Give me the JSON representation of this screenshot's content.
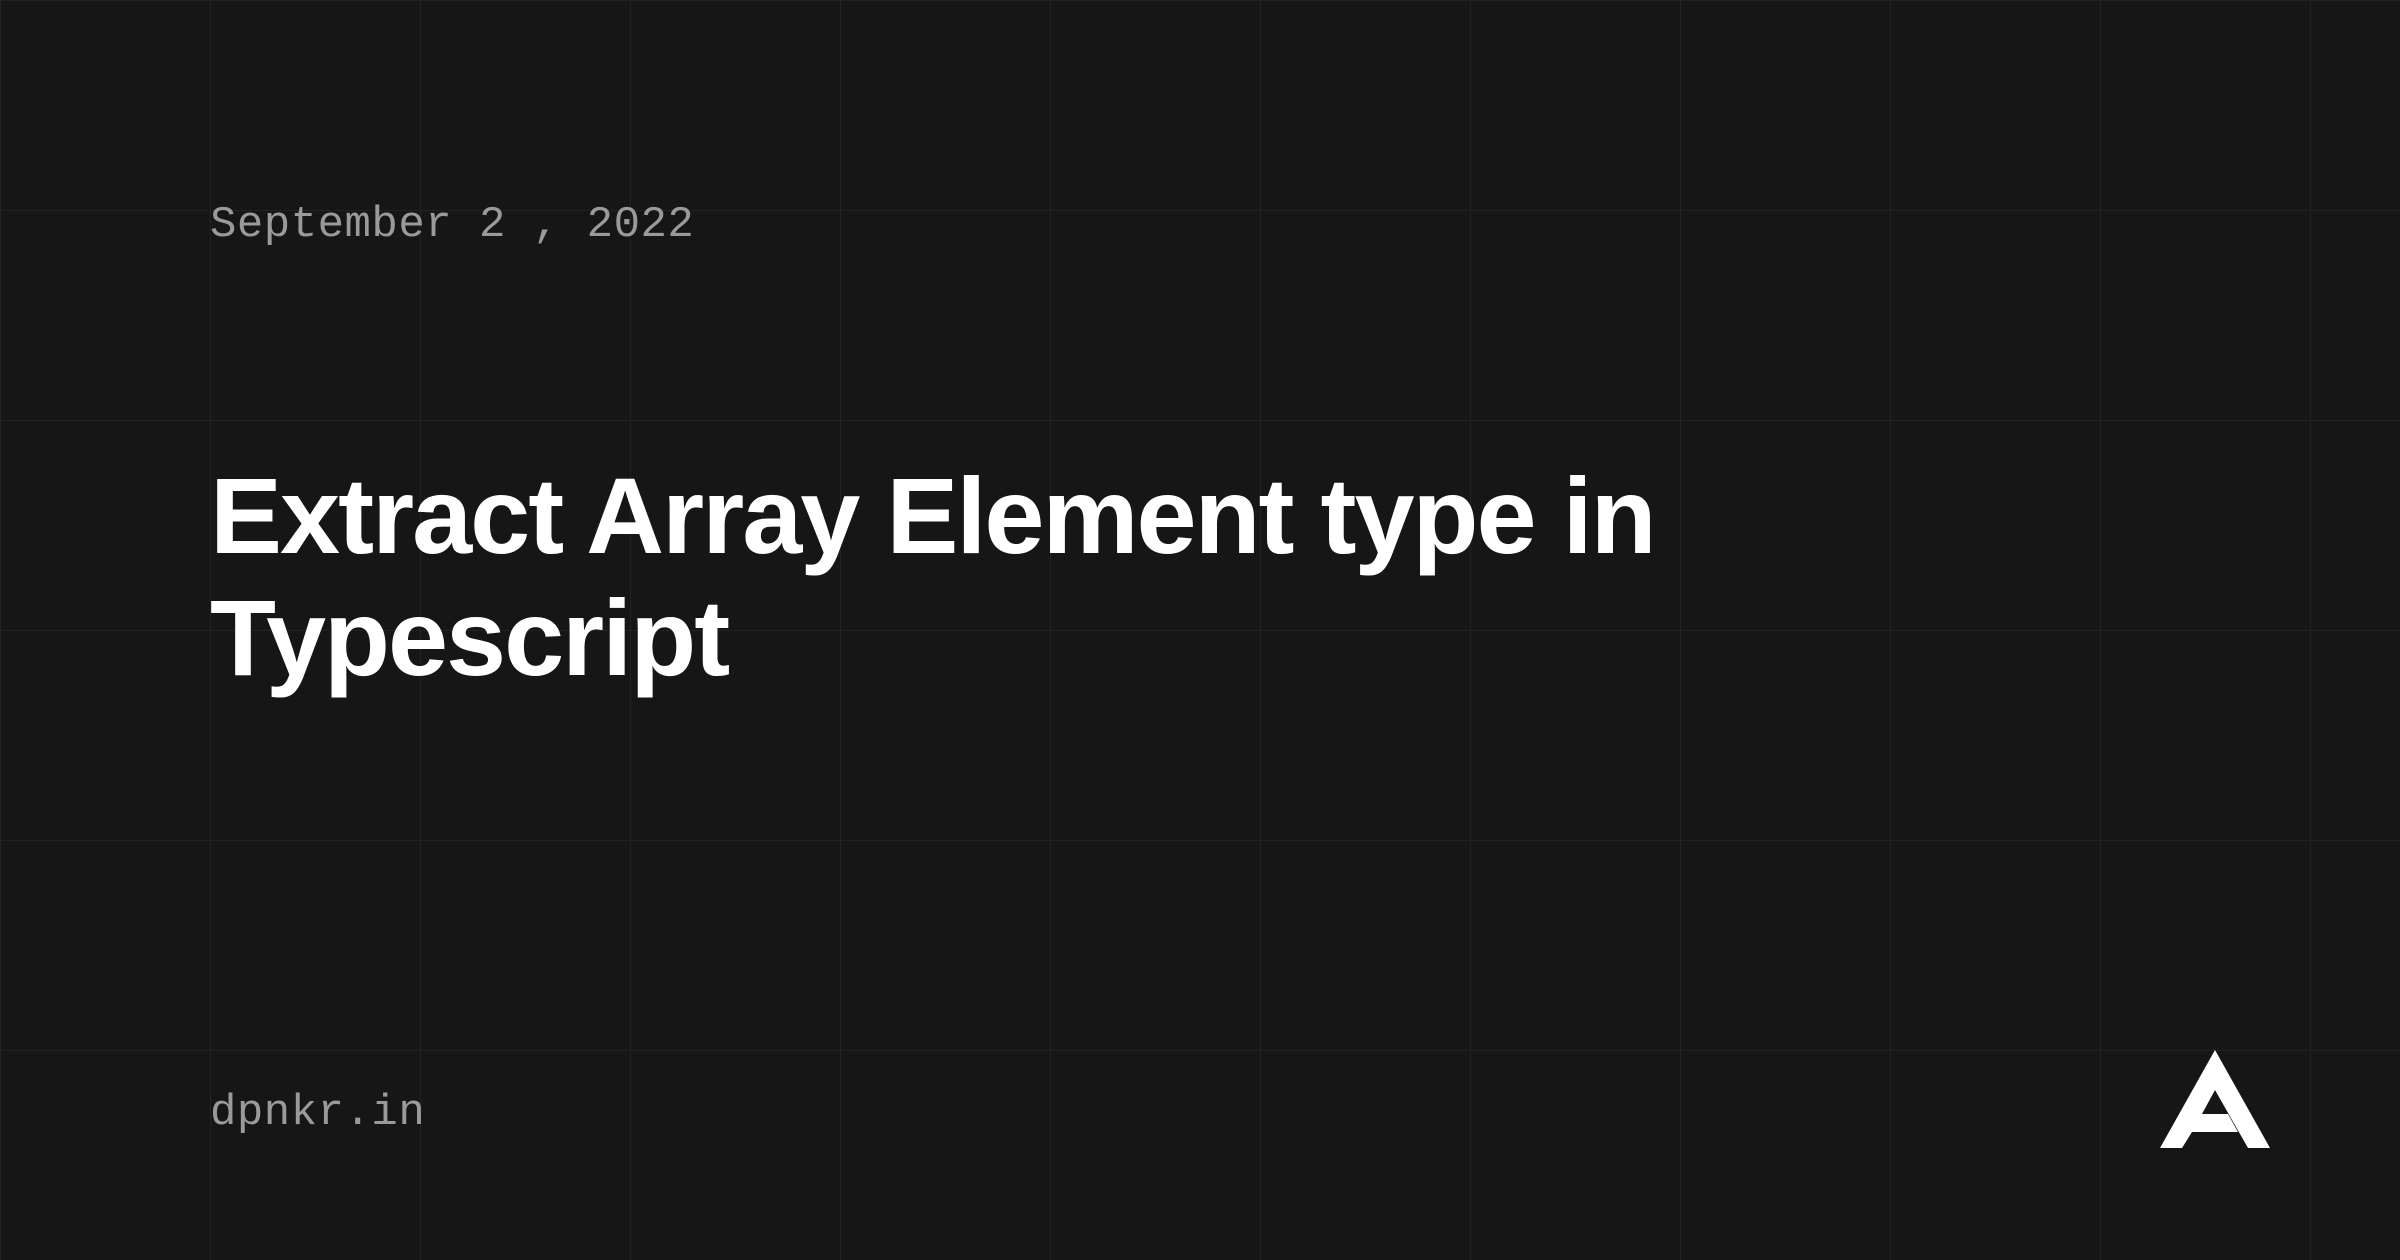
{
  "date": "September 2 , 2022",
  "title": "Extract Array Element type in Typescript",
  "site": "dpnkr.in"
}
